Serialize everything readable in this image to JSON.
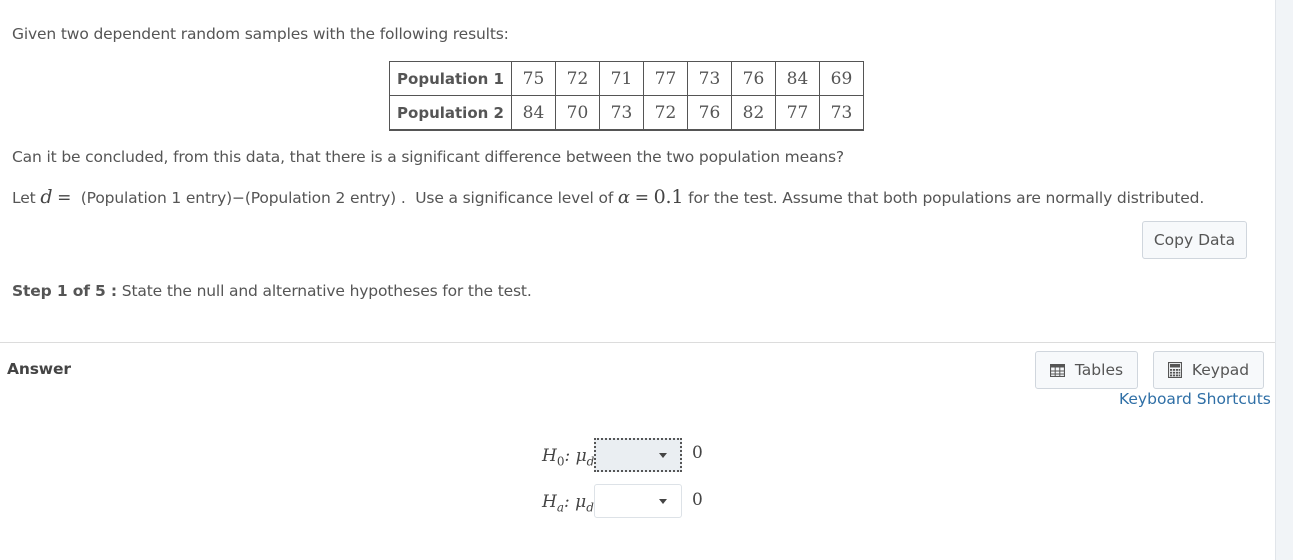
{
  "question": {
    "intro": "Given two dependent random samples with the following results:",
    "table": {
      "rows": [
        {
          "label": "Population 1",
          "values": [
            "75",
            "72",
            "71",
            "77",
            "73",
            "76",
            "84",
            "69"
          ]
        },
        {
          "label": "Population 2",
          "values": [
            "84",
            "70",
            "73",
            "72",
            "76",
            "82",
            "77",
            "73"
          ]
        }
      ]
    },
    "prompt": "Can it be concluded, from this data, that there is a significant difference between the two population means?",
    "definition": {
      "let": "Let",
      "var": "d",
      "equals": "=",
      "expr": "(Population 1 entry)−(Population 2 entry)",
      "sep": ".",
      "sig_prefix": "Use a significance level of",
      "alpha_symbol": "α",
      "alpha_equals": "=",
      "alpha_value": "0.1",
      "suffix": "for the test.  Assume that both populations are normally distributed."
    },
    "copy_data_label": "Copy Data"
  },
  "step": {
    "label": "Step 1 of 5 :",
    "text": "State the null and alternative hypotheses for the test."
  },
  "answer": {
    "heading": "Answer",
    "tables_label": "Tables",
    "keypad_label": "Keypad",
    "keyboard_shortcuts_label": "Keyboard Shortcuts",
    "hypotheses": [
      {
        "symbol": "H",
        "sub": "0",
        "param": "μ",
        "param_sub": "d",
        "selected": "",
        "value": "0",
        "focused": true
      },
      {
        "symbol": "H",
        "sub": "a",
        "param": "μ",
        "param_sub": "d",
        "selected": "",
        "value": "0",
        "focused": false
      }
    ]
  },
  "icons": {
    "tables": "table-grid-icon",
    "keypad": "calculator-icon",
    "dropdown": "caret-down-icon"
  }
}
